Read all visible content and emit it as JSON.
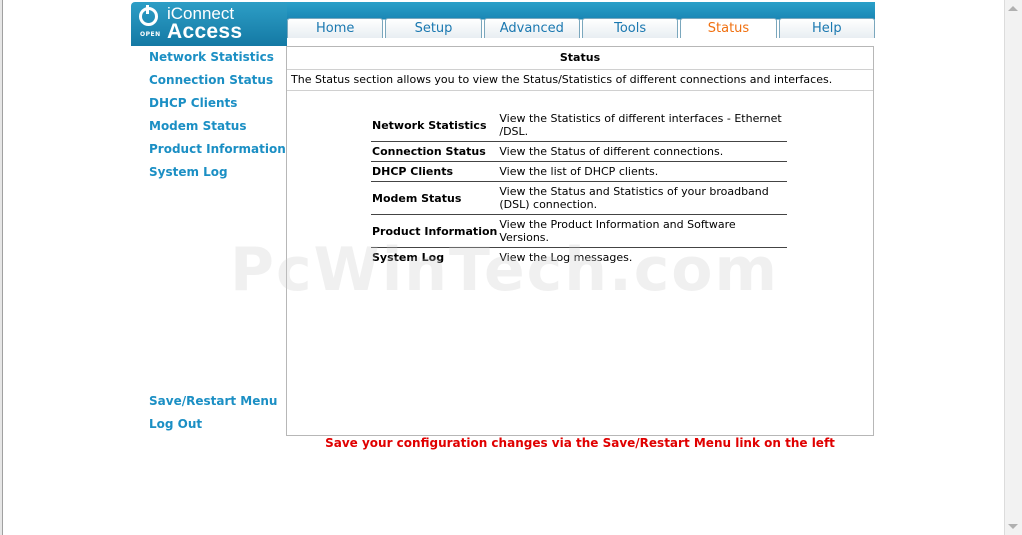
{
  "brand": {
    "open_label": "OPEN",
    "line1": "iConnect",
    "line2": "Access"
  },
  "tabs": [
    {
      "label": "Home",
      "active": false
    },
    {
      "label": "Setup",
      "active": false
    },
    {
      "label": "Advanced",
      "active": false
    },
    {
      "label": "Tools",
      "active": false
    },
    {
      "label": "Status",
      "active": true
    },
    {
      "label": "Help",
      "active": false
    }
  ],
  "sidebar": {
    "items": [
      {
        "label": "Network Statistics"
      },
      {
        "label": "Connection Status"
      },
      {
        "label": "DHCP Clients"
      },
      {
        "label": "Modem Status"
      },
      {
        "label": "Product Information"
      },
      {
        "label": "System Log"
      }
    ],
    "bottom_items": [
      {
        "label": "Save/Restart Menu"
      },
      {
        "label": "Log Out"
      }
    ]
  },
  "content": {
    "title": "Status",
    "intro": "The Status section allows you to view the Status/Statistics of different connections and interfaces.",
    "rows": [
      {
        "name": "Network Statistics",
        "desc": "View the Statistics of different interfaces - Ethernet /DSL."
      },
      {
        "name": "Connection Status",
        "desc": "View the Status of different connections."
      },
      {
        "name": "DHCP Clients",
        "desc": "View the list of DHCP clients."
      },
      {
        "name": "Modem Status",
        "desc": "View the Status and Statistics of your broadband (DSL) connection."
      },
      {
        "name": "Product Information",
        "desc": "View the Product Information and Software Versions."
      },
      {
        "name": "System Log",
        "desc": "View the Log messages."
      }
    ]
  },
  "save_note": "Save your configuration changes via the Save/Restart Menu link on the left",
  "watermark": "PcWinTech.com",
  "colors": {
    "brand_blue": "#1a86b4",
    "link_blue": "#1b8fc4",
    "active_tab": "#f07010",
    "warning_red": "#e00000"
  }
}
